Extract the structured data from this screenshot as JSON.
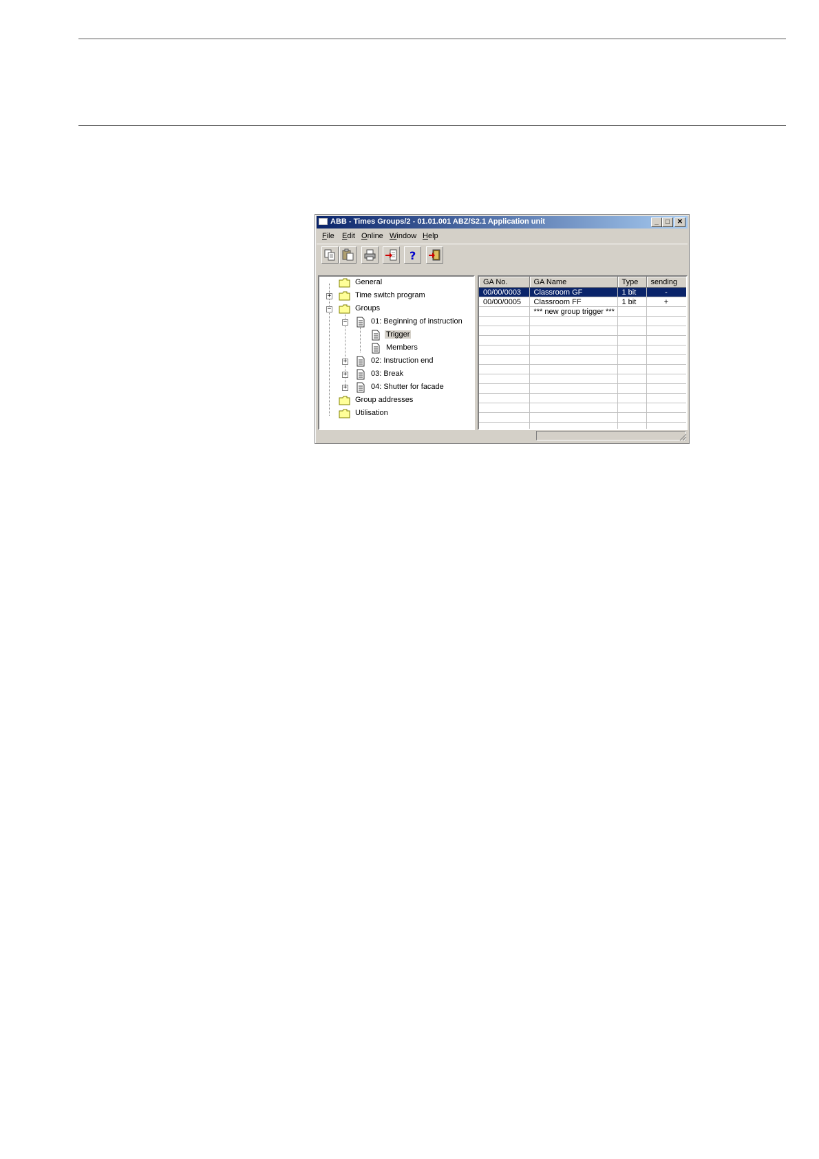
{
  "window": {
    "title": "ABB - Times Groups/2 - 01.01.001 ABZ/S2.1 Application unit",
    "min_glyph": "_",
    "max_glyph": "□",
    "close_glyph": "✕"
  },
  "menu": [
    "File",
    "Edit",
    "Online",
    "Window",
    "Help"
  ],
  "toolbar": {
    "buttons": [
      "copy-icon",
      "paste-icon",
      "print-icon",
      "import-icon",
      "help-icon",
      "exit-icon"
    ]
  },
  "tree": {
    "items": [
      {
        "label": "General"
      },
      {
        "label": "Time switch program",
        "expander": "+"
      },
      {
        "label": "Groups",
        "expander": "−"
      },
      {
        "label": "01: Beginning of instruction",
        "expander": "−"
      },
      {
        "label": "Trigger"
      },
      {
        "label": "Members"
      },
      {
        "label": "02: Instruction end",
        "expander": "+"
      },
      {
        "label": "03: Break",
        "expander": "+"
      },
      {
        "label": "04: Shutter for facade",
        "expander": "+"
      },
      {
        "label": "Group addresses"
      },
      {
        "label": "Utilisation"
      }
    ]
  },
  "grid": {
    "columns": [
      "GA No.",
      "GA Name",
      "Type",
      "sending"
    ],
    "rows": [
      [
        "00/00/0003",
        "Classroom GF",
        "1 bit",
        "-"
      ],
      [
        "00/00/0005",
        "Classroom FF",
        "1 bit",
        "+"
      ],
      [
        "",
        "*** new group trigger ***",
        "",
        ""
      ]
    ]
  }
}
